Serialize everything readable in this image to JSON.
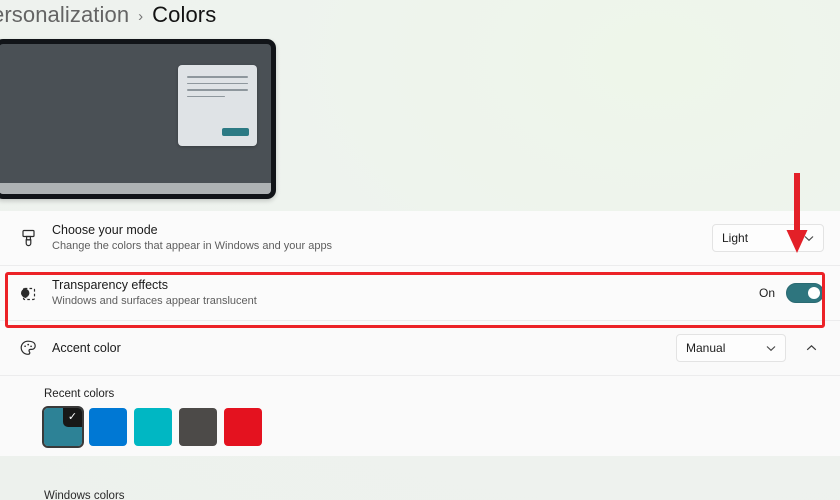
{
  "breadcrumb": {
    "parent": "ersonalization",
    "separator": "›",
    "current": "Colors"
  },
  "preview": {
    "name": "colors-preview",
    "desktop_color": "#4a5055",
    "dialog_color": "#dfe3e6",
    "accent_button_color": "#2c7a84",
    "taskbar_color": "#aeb2b4"
  },
  "settings": {
    "mode_row": {
      "icon": "paintbrush-icon",
      "title": "Choose your mode",
      "subtitle": "Change the colors that appear in Windows and your apps",
      "dropdown_value": "Light"
    },
    "transparency_row": {
      "icon": "transparency-icon",
      "title": "Transparency effects",
      "subtitle": "Windows and surfaces appear translucent",
      "toggle_label": "On",
      "toggle_state": "on",
      "toggle_color": "#2e757e"
    },
    "accent_row": {
      "icon": "palette-icon",
      "title": "Accent color",
      "dropdown_value": "Manual",
      "expander_icon": "chevron-up-icon"
    },
    "recent_colors": {
      "label": "Recent colors",
      "swatches": [
        {
          "color": "#2d8296",
          "selected": true,
          "check": "✓"
        },
        {
          "color": "#0078d4",
          "selected": false,
          "check": ""
        },
        {
          "color": "#00b7c3",
          "selected": false,
          "check": ""
        },
        {
          "color": "#4c4a48",
          "selected": false,
          "check": ""
        },
        {
          "color": "#e4121f",
          "selected": false,
          "check": ""
        }
      ]
    },
    "windows_colors_label": "Windows colors"
  },
  "annotations": {
    "arrow_color": "#e32028",
    "highlight_color": "#ec2227"
  }
}
